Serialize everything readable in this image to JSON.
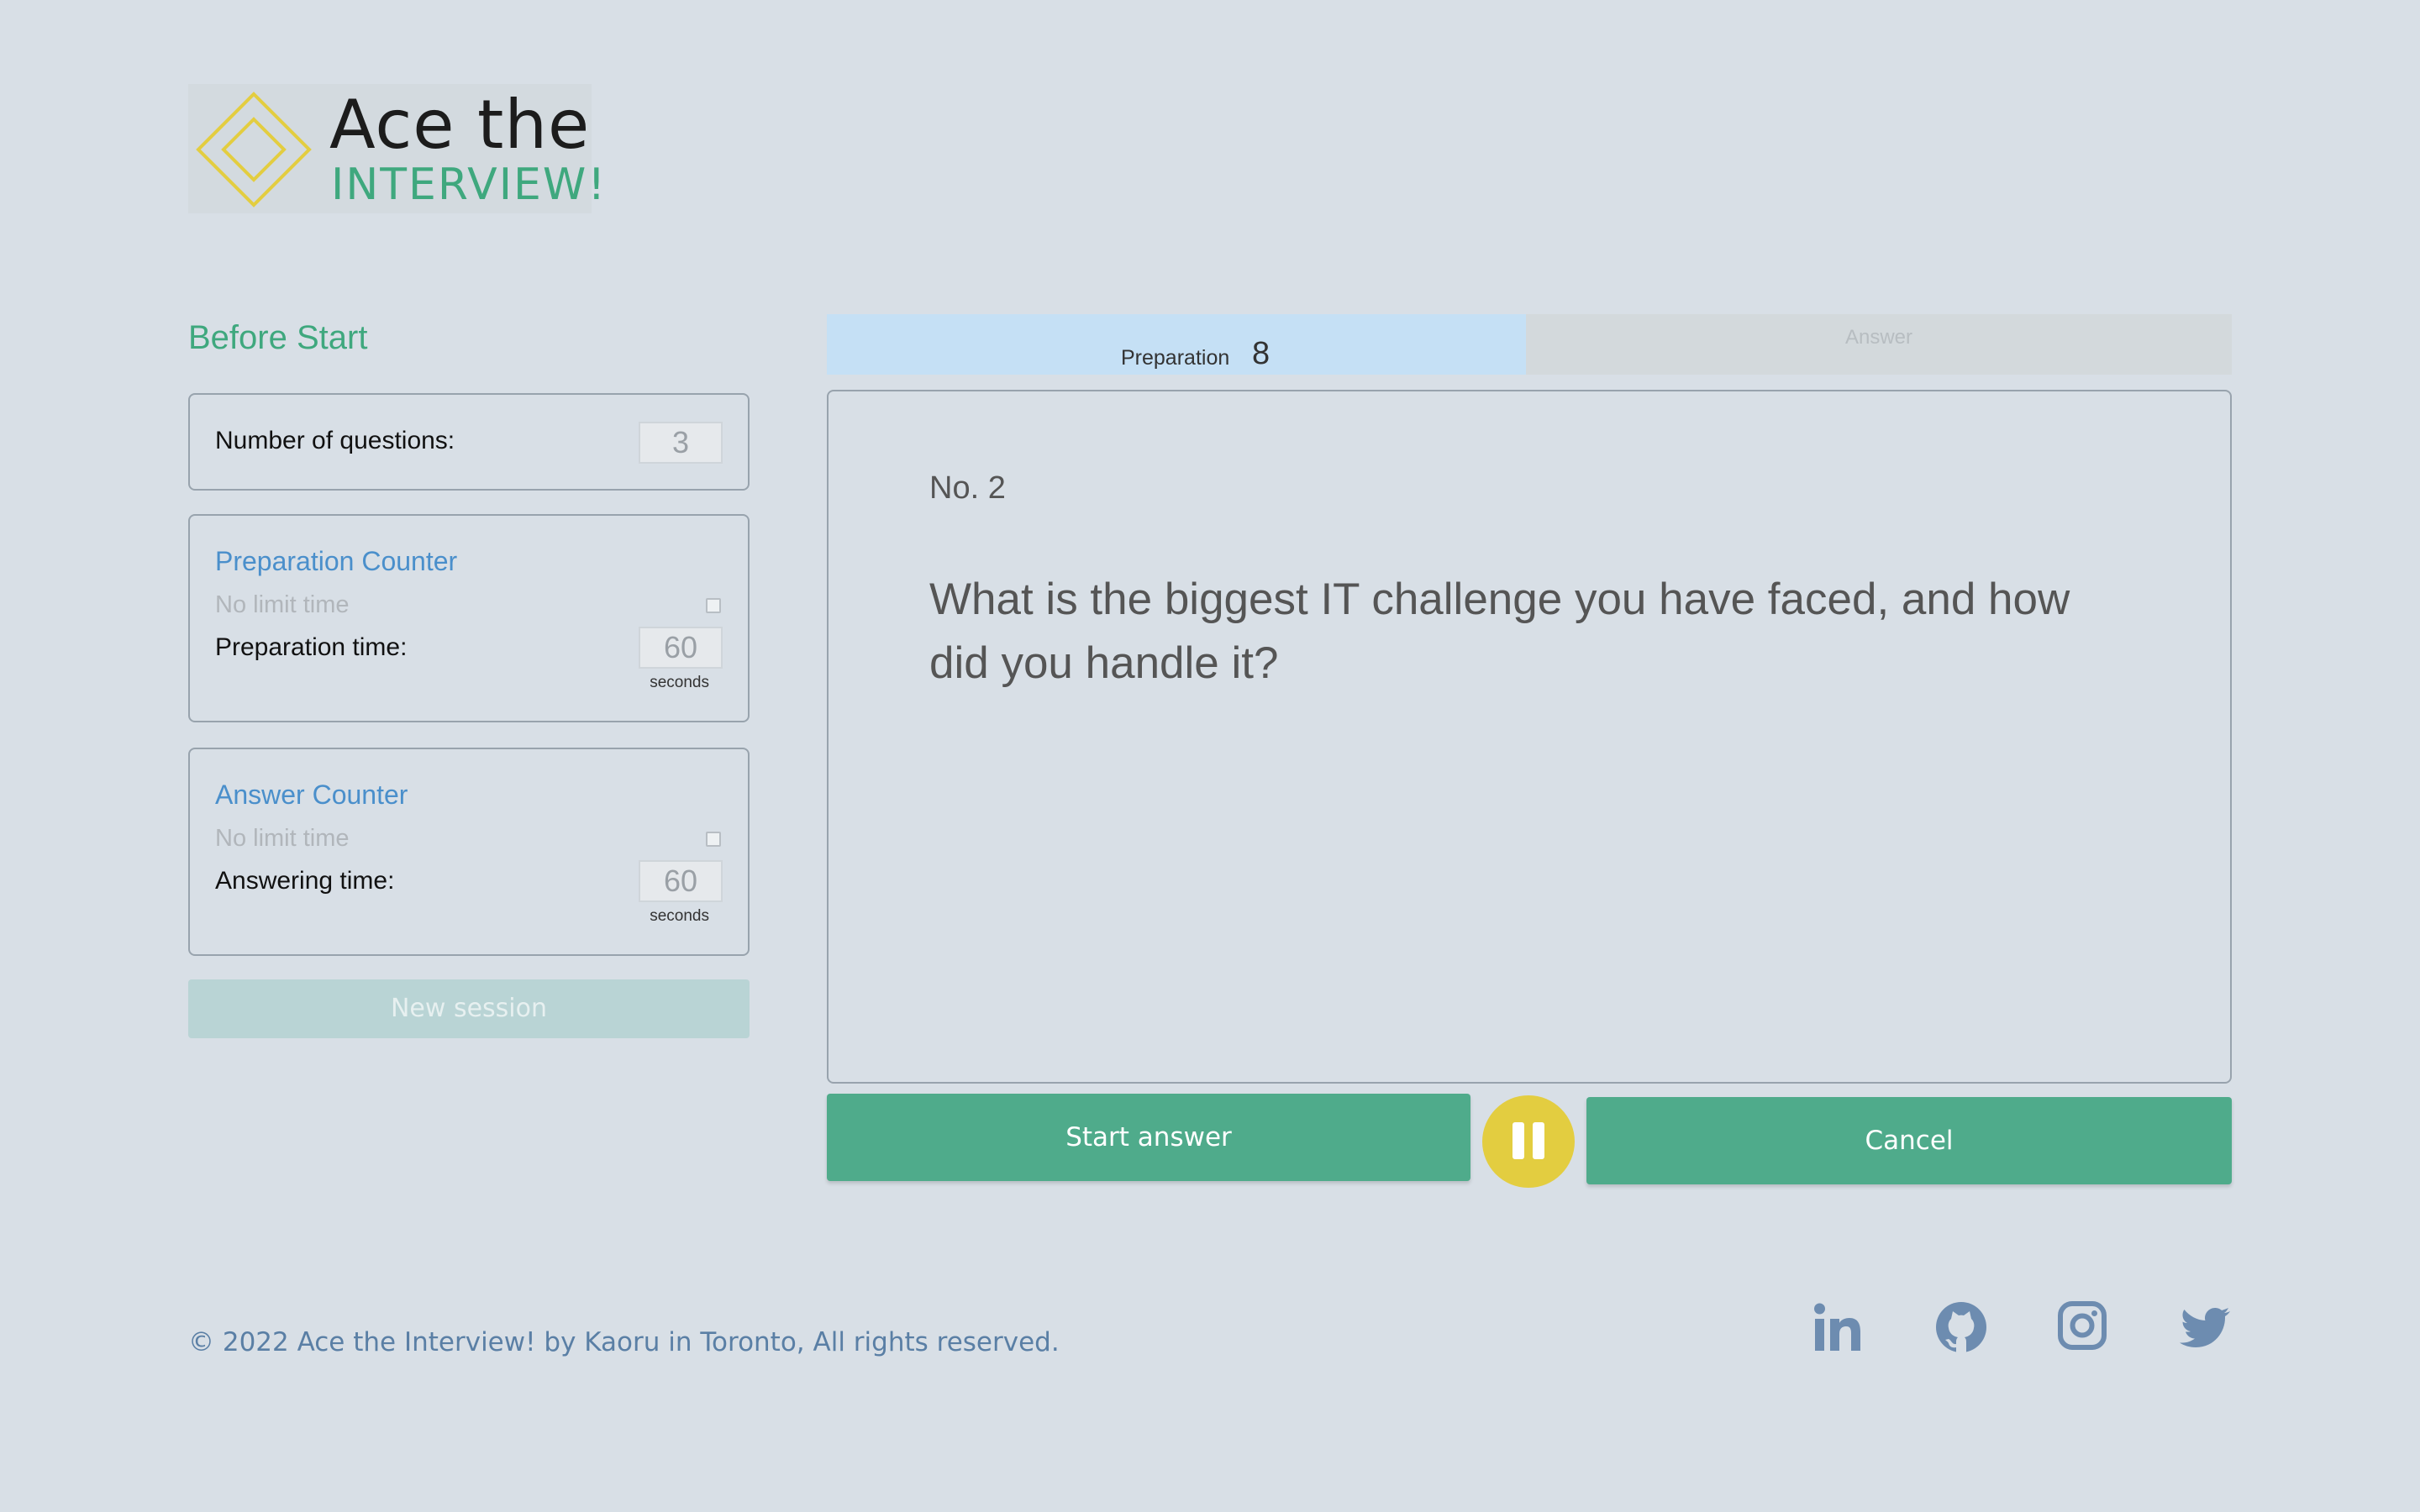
{
  "logo": {
    "line1": "Ace the",
    "line2": "INTERVIEW!"
  },
  "settings": {
    "title": "Before Start",
    "questions": {
      "label": "Number of questions:",
      "value": "3"
    },
    "preparation": {
      "title": "Preparation Counter",
      "no_limit": "No limit time",
      "label": "Preparation time:",
      "value": "60",
      "unit": "seconds"
    },
    "answer": {
      "title": "Answer Counter",
      "no_limit": "No limit time",
      "label": "Answering time:",
      "value": "60",
      "unit": "seconds"
    },
    "new_session": "New session"
  },
  "tabs": {
    "preparation": {
      "label": "Preparation",
      "count": "8"
    },
    "answer": {
      "label": "Answer"
    }
  },
  "question": {
    "number": "No. 2",
    "text": "What is the biggest IT challenge you have faced, and how did you handle it?"
  },
  "actions": {
    "start": "Start answer",
    "cancel": "Cancel"
  },
  "footer": {
    "copyright": "© 2022 Ace the Interview! by Kaoru in Toronto, All rights reserved.",
    "social": [
      "linkedin-icon",
      "github-icon",
      "instagram-icon",
      "twitter-icon"
    ]
  },
  "colors": {
    "accent": "#4fab8b",
    "pause": "#e3cd40",
    "link": "#4a8fcb",
    "background": "#d8dfe6"
  }
}
